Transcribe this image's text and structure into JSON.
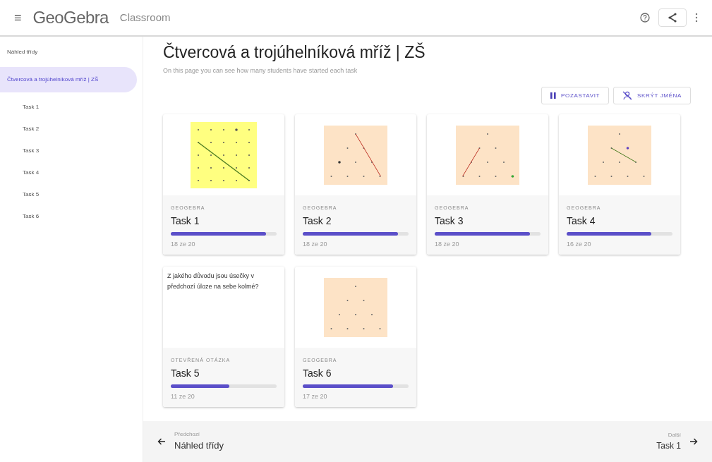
{
  "header": {
    "menu_icon": "≡",
    "logo": "GeoGebra",
    "product": "Classroom"
  },
  "sidebar": {
    "items": [
      {
        "label": "Náhled třídy",
        "selected": false
      },
      {
        "label": "Čtvercová a trojúhelníková mříž | ZŠ",
        "selected": true,
        "children": [
          {
            "label": "Task 1",
            "selected": false
          },
          {
            "label": "Task 2",
            "selected": false
          },
          {
            "label": "Task 3",
            "selected": false
          },
          {
            "label": "Task 4",
            "selected": false
          },
          {
            "label": "Task 5",
            "selected": false
          },
          {
            "label": "Task 6",
            "selected": false
          }
        ]
      }
    ]
  },
  "page": {
    "title": "Čtvercová a trojúhelníková mříž | ZŠ",
    "subtitle": "On this page you can see how many students have started each task",
    "buttons": [
      {
        "kind": "pause",
        "label": "POZASTAVIT"
      },
      {
        "kind": "hide_names",
        "label": "SKRÝT JMÉNA"
      }
    ]
  },
  "tasks": [
    {
      "kind": "square",
      "type_label": "GEOGEBRA",
      "title": "Task 1",
      "level": 0.9,
      "count": "18 ze 20"
    },
    {
      "kind": "triangle",
      "type_label": "GEOGEBRA",
      "title": "Task 2",
      "level": 0.9,
      "count": "18 ze 20"
    },
    {
      "kind": "triangle",
      "type_label": "GEOGEBRA",
      "title": "Task 3",
      "level": 0.9,
      "count": "18 ze 20"
    },
    {
      "kind": "triangle",
      "type_label": "GEOGEBRA",
      "title": "Task 4",
      "level": 0.8,
      "count": "16 ze 20"
    },
    {
      "kind": "question",
      "question": "Z jakého důvodu jsou úsečky v předchozí úloze na sebe kolmé?",
      "type_label": "OTEVŘENÁ OTÁZKA",
      "title": "Task 5",
      "level": 0.55,
      "count": "11 ze 20"
    },
    {
      "kind": "triangle",
      "type_label": "GEOGEBRA",
      "title": "Task 6",
      "level": 0.85,
      "count": "17 ze 20"
    }
  ],
  "footer": {
    "previous": {
      "label": "Předchozí",
      "target": "Náhled třídy"
    },
    "next": {
      "label": "Další",
      "target": "Task 1"
    }
  }
}
